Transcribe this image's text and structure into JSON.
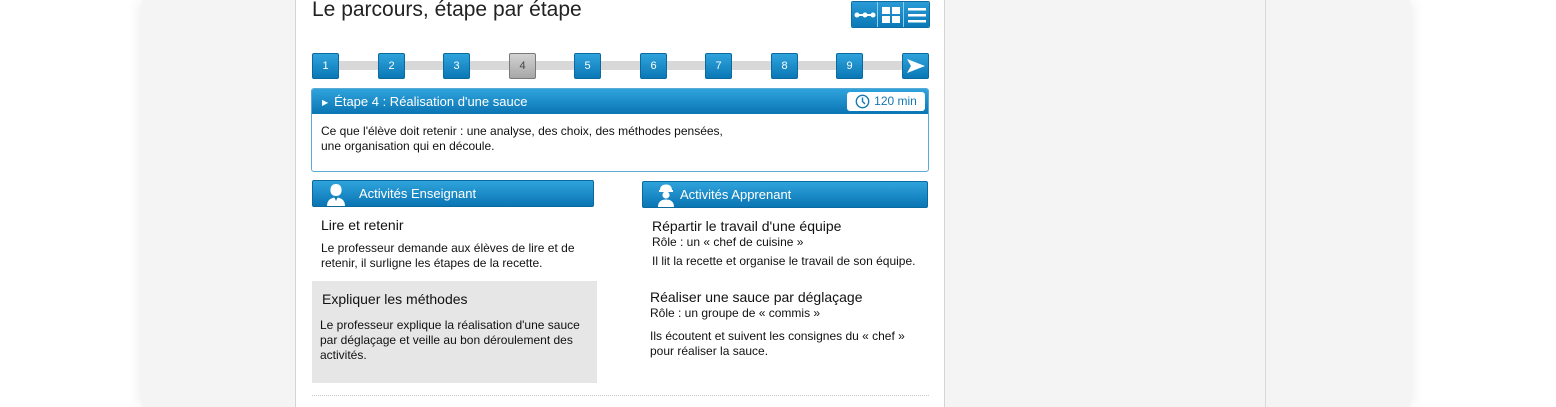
{
  "page": {
    "title": "Le parcours, étape par étape"
  },
  "view_switch": {
    "buttons": [
      {
        "icon": "timeline-view-icon"
      },
      {
        "icon": "grid-view-icon"
      },
      {
        "icon": "list-view-icon"
      }
    ]
  },
  "steps": {
    "items": [
      "1",
      "2",
      "3",
      "4",
      "5",
      "6",
      "7",
      "8",
      "9"
    ],
    "active": "4",
    "next_icon": "next-arrow-icon"
  },
  "stage": {
    "title": "Étape 4 : Réalisation d'une sauce",
    "duration": "120 min",
    "duration_icon": "clock-icon",
    "body_line1": "Ce que l'élève doit retenir : une analyse, des choix, des méthodes pensées,",
    "body_line2": "une organisation qui en découle."
  },
  "teacher": {
    "header": "Activités Enseignant",
    "icon": "teacher-icon",
    "items": [
      {
        "title": "Lire et retenir",
        "line1": "Le professeur demande aux élèves de lire et de",
        "line2": "retenir, il surligne les étapes de la recette."
      },
      {
        "title": "Expliquer les méthodes",
        "line1": "Le professeur explique la réalisation d'une sauce",
        "line2": "par déglaçage et veille au bon déroulement des",
        "line3": "activités."
      }
    ]
  },
  "learner": {
    "header": "Activités Apprenant",
    "icon": "learner-icon",
    "items": [
      {
        "title": "Répartir le travail d'une équipe",
        "role": "Rôle : un « chef de cuisine »",
        "line1": "Il lit la recette et organise le travail de son équipe."
      },
      {
        "title": "Réaliser une sauce par déglaçage",
        "role": "Rôle : un groupe de « commis »",
        "line1": "Ils écoutent et suivent les consignes du « chef »",
        "line2": "pour réaliser la sauce."
      }
    ]
  },
  "colors": {
    "accent": "#1a8bc9",
    "active_step": "#b9b9b9",
    "highlight": "#e6e6e6"
  }
}
